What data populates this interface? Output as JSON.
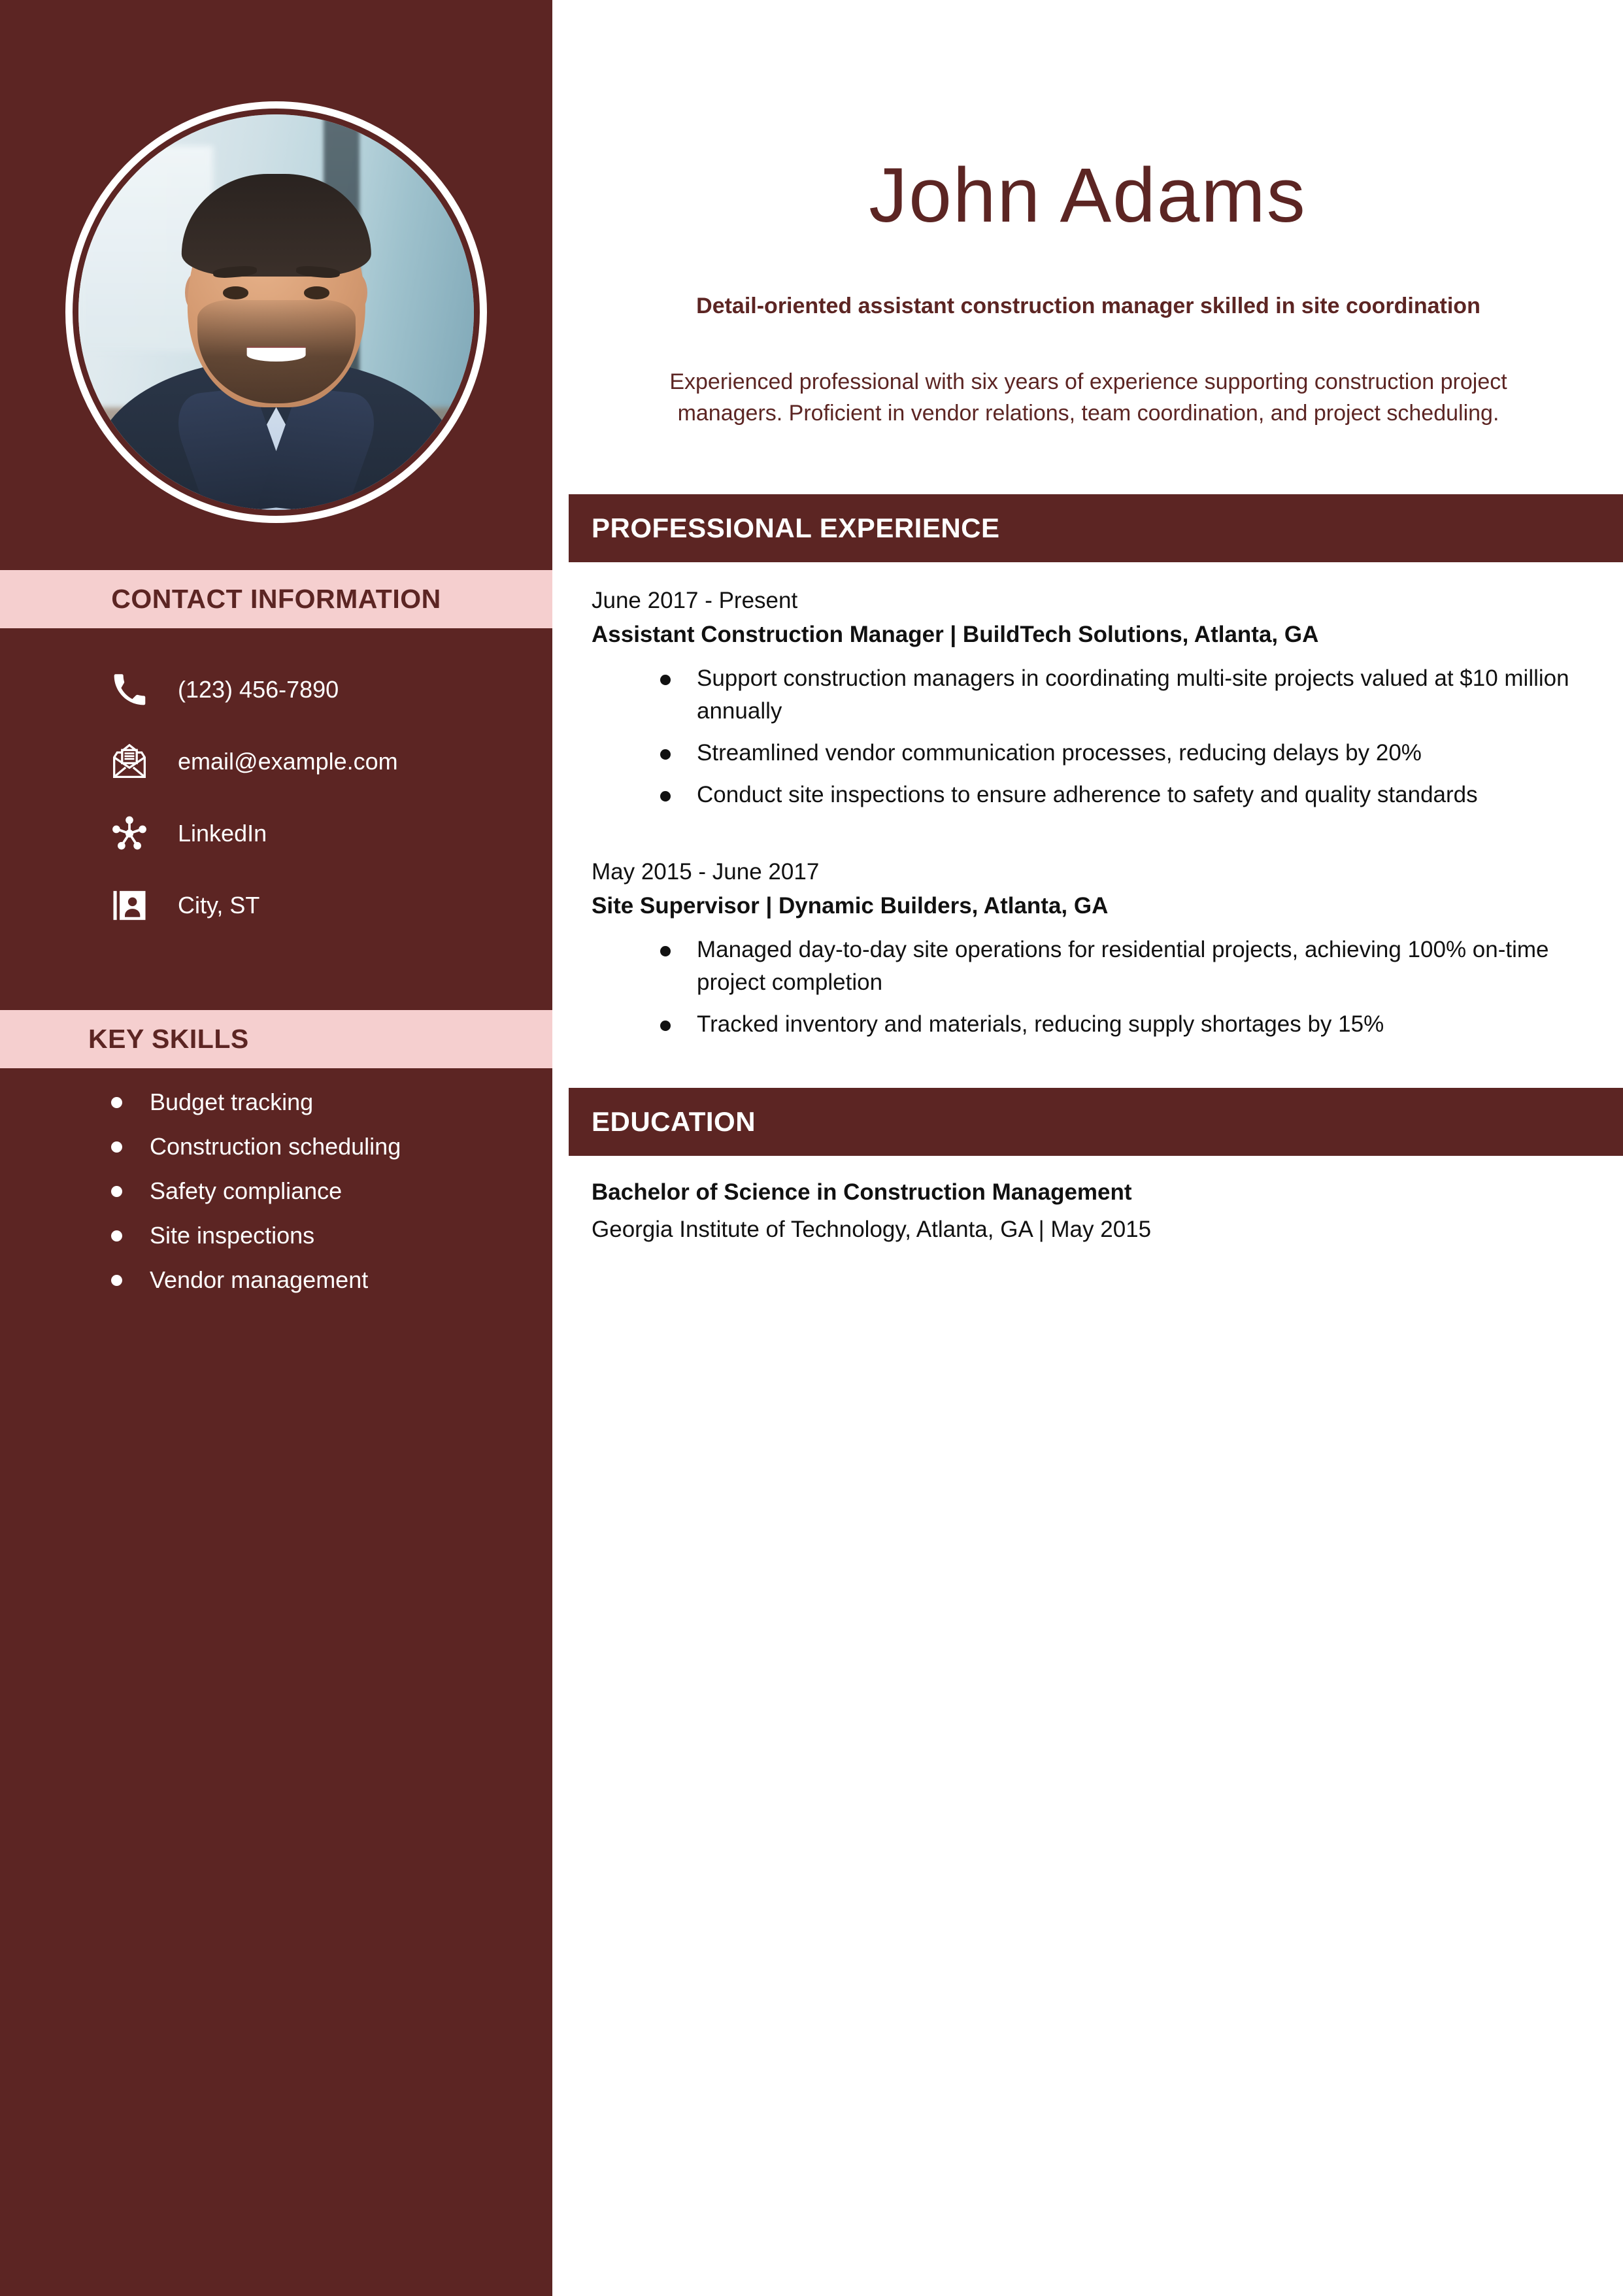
{
  "profile": {
    "name": "John Adams",
    "tagline": "Detail-oriented assistant construction manager skilled in site coordination",
    "summary": "Experienced professional with six years of experience supporting construction project managers. Proficient in vendor relations, team coordination, and project scheduling.",
    "photo_alt": "headshot-photo"
  },
  "theme": {
    "sidebar_bg": "#5C2523",
    "band_bg": "#F5CFCF",
    "accent": "#5C2523",
    "text_light": "#FFFFFF",
    "text_dark": "#111111"
  },
  "sidebar": {
    "contact_heading": "CONTACT INFORMATION",
    "contacts": [
      {
        "icon": "phone-icon",
        "value": "(123) 456-7890"
      },
      {
        "icon": "envelope-icon",
        "value": "email@example.com"
      },
      {
        "icon": "share-network-icon",
        "value": "LinkedIn"
      },
      {
        "icon": "contact-card-icon",
        "value": "City, ST"
      }
    ],
    "skills_heading": "KEY SKILLS",
    "skills": [
      "Budget tracking",
      "Construction scheduling",
      "Safety compliance",
      "Site inspections",
      "Vendor management"
    ]
  },
  "main": {
    "experience_heading": "PROFESSIONAL EXPERIENCE",
    "jobs": [
      {
        "dates": "June 2017 - Present",
        "title": "Assistant Construction Manager | BuildTech Solutions, Atlanta, GA",
        "bullets": [
          "Support construction managers in coordinating multi-site projects valued at $10 million annually",
          "Streamlined vendor communication processes, reducing delays by 20%",
          "Conduct site inspections to ensure adherence to safety and quality standards"
        ]
      },
      {
        "dates": "May 2015 - June 2017",
        "title": "Site Supervisor | Dynamic Builders, Atlanta, GA",
        "bullets": [
          "Managed day-to-day site operations for residential projects, achieving 100% on-time project completion",
          "Tracked inventory and materials, reducing supply shortages by 15%"
        ]
      }
    ],
    "education_heading": "EDUCATION",
    "education": {
      "degree": "Bachelor of Science in Construction Management",
      "school": "Georgia Institute of Technology, Atlanta, GA | May 2015"
    }
  }
}
